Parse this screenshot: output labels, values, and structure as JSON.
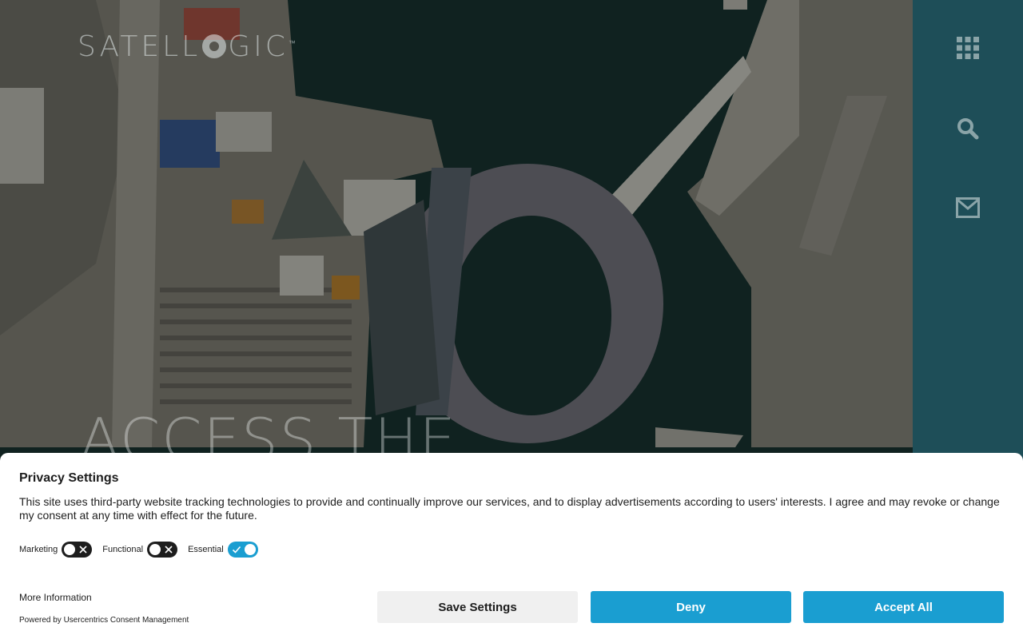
{
  "logo": {
    "text_left": "SATELL",
    "text_right": "GIC",
    "trademark": "™"
  },
  "hero": {
    "headline": "ACCESS THE"
  },
  "sidebar": {
    "items": [
      {
        "icon": "grid-menu-icon"
      },
      {
        "icon": "search-icon"
      },
      {
        "icon": "mail-icon"
      }
    ]
  },
  "consent": {
    "title": "Privacy Settings",
    "description": "This site uses third-party website tracking technologies to provide and continually improve our services, and to display advertisements according to users' interests. I agree and may revoke or change my consent at any time with effect for the future.",
    "toggles": [
      {
        "label": "Marketing",
        "state": "off"
      },
      {
        "label": "Functional",
        "state": "off"
      },
      {
        "label": "Essential",
        "state": "on"
      }
    ],
    "more_info": "More Information",
    "powered_by": "Powered by Usercentrics Consent Management",
    "buttons": {
      "save": "Save Settings",
      "deny": "Deny",
      "accept": "Accept All"
    }
  },
  "colors": {
    "accent": "#1a9ed1",
    "sidebar": "#1e4e58",
    "save_button_bg": "#f0f0f0"
  }
}
